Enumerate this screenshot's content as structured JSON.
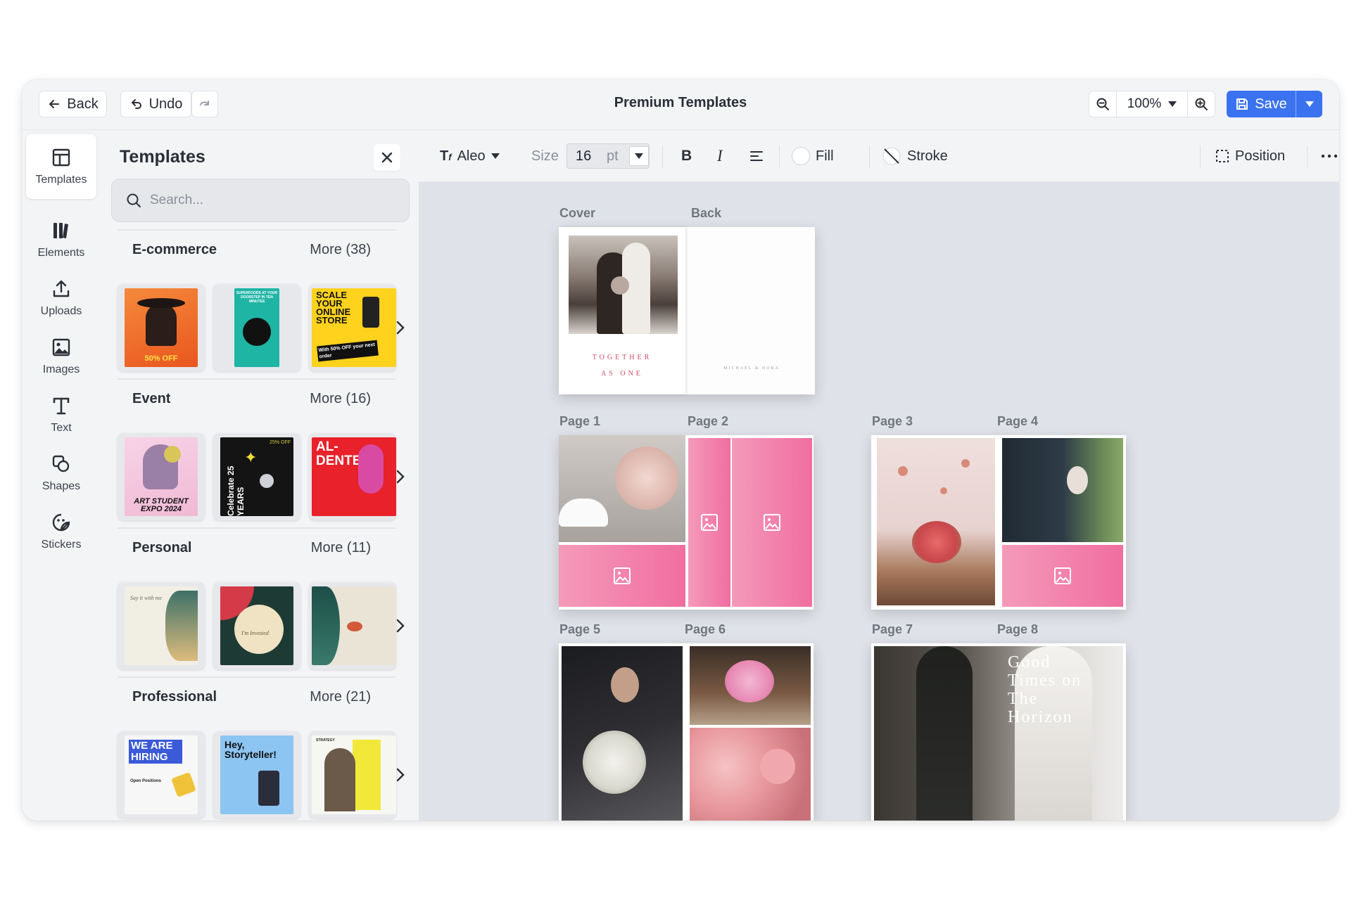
{
  "topbar": {
    "back_label": "Back",
    "undo_label": "Undo",
    "title": "Premium Templates",
    "zoom_value": "100%",
    "save_label": "Save"
  },
  "rail": {
    "items": [
      {
        "label": "Templates",
        "icon": "layout-icon"
      },
      {
        "label": "Elements",
        "icon": "elements-icon"
      },
      {
        "label": "Uploads",
        "icon": "upload-icon"
      },
      {
        "label": "Images",
        "icon": "image-icon"
      },
      {
        "label": "Text",
        "icon": "text-icon"
      },
      {
        "label": "Shapes",
        "icon": "shapes-icon"
      },
      {
        "label": "Stickers",
        "icon": "sticker-icon"
      }
    ]
  },
  "panel": {
    "title": "Templates",
    "search_placeholder": "Search...",
    "categories": [
      {
        "name": "E-commerce",
        "more": "More (38)",
        "thumbs": [
          {
            "text": "50% OFF"
          },
          {
            "text": "SUPERFOODS AT YOUR DOORSTEP IN TEN MINUTES"
          },
          {
            "text": "SCALE YOUR ONLINE STORE",
            "sub": "With 50% OFF your next order"
          }
        ]
      },
      {
        "name": "Event",
        "more": "More (16)",
        "thumbs": [
          {
            "text": "ART STUDENT EXPO 2024"
          },
          {
            "text": "Celebrate 25 YEARS",
            "sub": "25% OFF"
          },
          {
            "text": "AL-DENTE"
          }
        ]
      },
      {
        "name": "Personal",
        "more": "More (11)",
        "thumbs": [
          {
            "text": "Say it with me"
          },
          {
            "text": "I'm Invested"
          },
          {
            "text": ""
          }
        ]
      },
      {
        "name": "Professional",
        "more": "More (21)",
        "thumbs": [
          {
            "text": "WE ARE HIRING",
            "sub": "Open Positions"
          },
          {
            "text": "Hey, Storyteller!"
          },
          {
            "text": "STRATEGY"
          }
        ]
      }
    ]
  },
  "toolbar": {
    "font_name": "Aleo",
    "size_label": "Size",
    "size_value": "16",
    "size_unit": "pt",
    "fill_label": "Fill",
    "stroke_label": "Stroke",
    "position_label": "Position"
  },
  "canvas": {
    "labels": {
      "cover": "Cover",
      "back": "Back",
      "p1": "Page 1",
      "p2": "Page 2",
      "p3": "Page 3",
      "p4": "Page 4",
      "p5": "Page 5",
      "p6": "Page 6",
      "p7": "Page 7",
      "p8": "Page 8"
    },
    "cover_text_line1": "TOGETHER",
    "cover_text_line2": "AS ONE",
    "back_text": "MICHAEL & NORA",
    "page8_text": "Good Times on The Horizon"
  }
}
